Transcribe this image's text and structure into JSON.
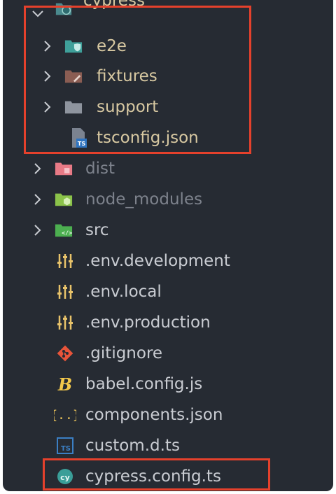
{
  "colors": {
    "background": "#262b33",
    "text_default": "#c9ccd2",
    "text_in_folder": "#d8c9a2",
    "text_dimmed": "#7d828c",
    "highlight": "#e5412c"
  },
  "tree": {
    "cypress": {
      "label": "cypress",
      "icon": "cypress-folder-icon"
    },
    "e2e": {
      "label": "e2e",
      "icon": "e2e-folder-icon"
    },
    "fixtures": {
      "label": "fixtures",
      "icon": "fixtures-folder-icon"
    },
    "support": {
      "label": "support",
      "icon": "support-folder-icon"
    },
    "tsconfig": {
      "label": "tsconfig.json",
      "icon": "typescript-config-file-icon"
    },
    "dist": {
      "label": "dist",
      "icon": "dist-folder-icon"
    },
    "node_modules": {
      "label": "node_modules",
      "icon": "node-modules-folder-icon"
    },
    "src": {
      "label": "src",
      "icon": "src-folder-icon"
    },
    "env_development": {
      "label": ".env.development",
      "icon": "env-file-icon"
    },
    "env_local": {
      "label": ".env.local",
      "icon": "env-file-icon"
    },
    "env_production": {
      "label": ".env.production",
      "icon": "env-file-icon"
    },
    "gitignore": {
      "label": ".gitignore",
      "icon": "git-icon"
    },
    "babel": {
      "label": "babel.config.js",
      "icon": "babel-icon"
    },
    "components": {
      "label": "components.json",
      "icon": "json-braces-icon"
    },
    "custom_d_ts": {
      "label": "custom.d.ts",
      "icon": "typescript-file-icon"
    },
    "cypress_config": {
      "label": "cypress.config.ts",
      "icon": "cypress-file-icon"
    }
  }
}
